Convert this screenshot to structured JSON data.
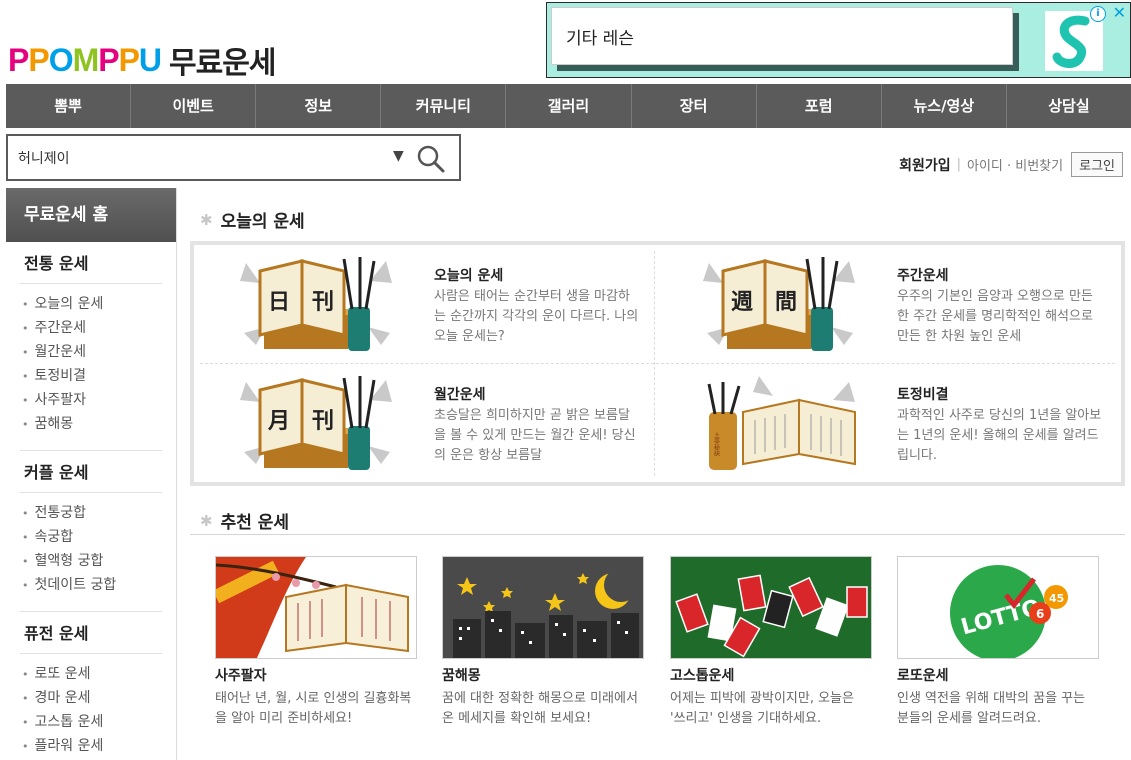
{
  "logo": {
    "brand_letters": [
      "P",
      "P",
      "O",
      "M",
      "P",
      "P",
      "U"
    ],
    "title": "무료운세"
  },
  "ad": {
    "text": "기타 레슨",
    "info_icon": "i",
    "close_icon": "✕",
    "colors": {
      "bg": "#a9eee1",
      "logo": "#1fc4b0"
    }
  },
  "nav": [
    "뽐뿌",
    "이벤트",
    "정보",
    "커뮤니티",
    "갤러리",
    "장터",
    "포럼",
    "뉴스/영상",
    "상담실"
  ],
  "search": {
    "value": "허니제이",
    "dropdown_icon": "▼"
  },
  "member": {
    "join": "회원가입",
    "find": "아이디 · 비번찾기",
    "login": "로그인"
  },
  "sidebar": {
    "home": "무료운세 홈",
    "sections": [
      {
        "title": "전통 운세",
        "items": [
          "오늘의 운세",
          "주간운세",
          "월간운세",
          "토정비결",
          "사주팔자",
          "꿈해몽"
        ]
      },
      {
        "title": "커플 운세",
        "items": [
          "전통궁합",
          "속궁합",
          "혈액형 궁합",
          "첫데이트 궁합"
        ]
      },
      {
        "title": "퓨전 운세",
        "items": [
          "로또 운세",
          "경마 운세",
          "고스톱 운세",
          "플라워 운세"
        ]
      }
    ]
  },
  "today": {
    "heading": "오늘의 운세",
    "items": [
      {
        "title": "오늘의 운세",
        "desc": "사람은 태어는 순간부터 생을 마감하는 순간까지 각각의 운이 다르다. 나의 오늘 운세는?",
        "chars": [
          "日",
          "刊"
        ]
      },
      {
        "title": "주간운세",
        "desc": "우주의 기본인 음양과 오행으로 만든 한 주간 운세를 명리학적인 해석으로 만든 한 차원 높인 운세",
        "chars": [
          "週",
          "間"
        ]
      },
      {
        "title": "월간운세",
        "desc": "초승달은 희미하지만 곧 밝은 보름달을 볼 수 있게 만드는 월간 운세! 당신의 운은 항상 보름달",
        "chars": [
          "月",
          "刊"
        ]
      },
      {
        "title": "토정비결",
        "desc": "과학적인 사주로 당신의 1년을 알아보는 1년의 운세! 올해의 운세를 알려드립니다.",
        "chars": [
          "土亭秘訣"
        ]
      }
    ]
  },
  "recommend": {
    "heading": "추천 운세",
    "items": [
      {
        "title": "사주팔자",
        "desc": "태어난 년, 월, 시로 인생의 길흉화복을 알아 미리 준비하세요!"
      },
      {
        "title": "꿈해몽",
        "desc": "꿈에 대한 정확한 해몽으로 미래에서 온 메세지를 확인해 보세요!"
      },
      {
        "title": "고스톱운세",
        "desc": "어제는 피박에 광박이지만, 오늘은 '쓰리고' 인생을 기대하세요."
      },
      {
        "title": "로또운세",
        "desc": "인생 역전을 위해 대박의 꿈을 꾸는 분들의 운세를 알려드려요.",
        "badge": "LOTTO",
        "numbers": [
          "6",
          "45"
        ]
      }
    ]
  },
  "colors": {
    "nav": "#5b5b5b",
    "brand": [
      "#e5007f",
      "#f39800",
      "#00a0e9",
      "#8fc31f",
      "#e5007f",
      "#f39800",
      "#00a0e9"
    ]
  }
}
